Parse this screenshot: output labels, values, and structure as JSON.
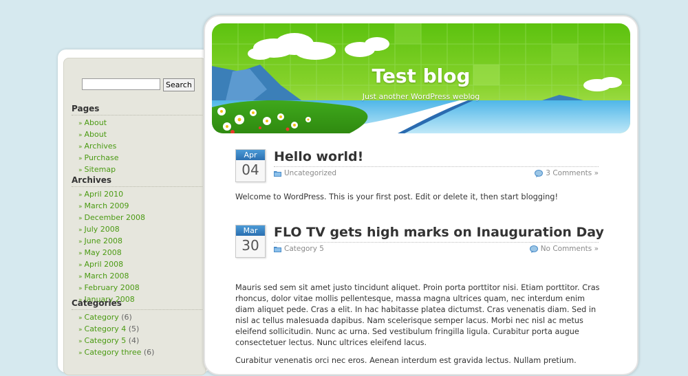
{
  "search": {
    "placeholder": "",
    "button_label": "Search"
  },
  "sidebar": {
    "pages": {
      "heading": "Pages",
      "items": [
        "About",
        "About",
        "Archives",
        "Purchase",
        "Sitemap"
      ]
    },
    "archives": {
      "heading": "Archives",
      "items": [
        "April 2010",
        "March 2009",
        "December 2008",
        "July 2008",
        "June 2008",
        "May 2008",
        "April 2008",
        "March 2008",
        "February 2008",
        "January 2008"
      ]
    },
    "categories": {
      "heading": "Categories",
      "items": [
        {
          "label": "Category",
          "count": "(6)"
        },
        {
          "label": "Category 4",
          "count": "(5)"
        },
        {
          "label": "Category 5",
          "count": "(4)"
        },
        {
          "label": "Category three",
          "count": "(6)"
        }
      ]
    }
  },
  "header": {
    "title": "Test blog",
    "tagline": "Just another WordPress weblog"
  },
  "posts": [
    {
      "month": "Apr",
      "day": "04",
      "title": "Hello world!",
      "category": "Uncategorized",
      "comments": "3 Comments »",
      "paragraphs": [
        "Welcome to WordPress. This is your first post. Edit or delete it, then start blogging!"
      ]
    },
    {
      "month": "Mar",
      "day": "30",
      "title": "FLO TV gets high marks on Inauguration Day",
      "category": "Category 5",
      "comments": "No Comments »",
      "paragraphs": [
        "Mauris sed sem sit amet justo tincidunt aliquet. Proin porta porttitor nisi. Etiam porttitor. Cras rhoncus, dolor vitae mollis pellentesque, massa magna ultrices quam, nec interdum enim diam aliquet pede. Cras a elit. In hac habitasse platea dictumst. Cras venenatis diam. Sed in nisl ac tellus malesuada dapibus. Nam scelerisque semper lacus. Morbi nec nisl ac metus eleifend sollicitudin. Nunc ac urna. Sed vestibulum fringilla ligula. Curabitur porta augue consectetuer lectus. Nunc ultrices eleifend lacus.",
        "Curabitur venenatis orci nec eros. Aenean interdum est gravida lectus. Nullam pretium."
      ]
    }
  ]
}
